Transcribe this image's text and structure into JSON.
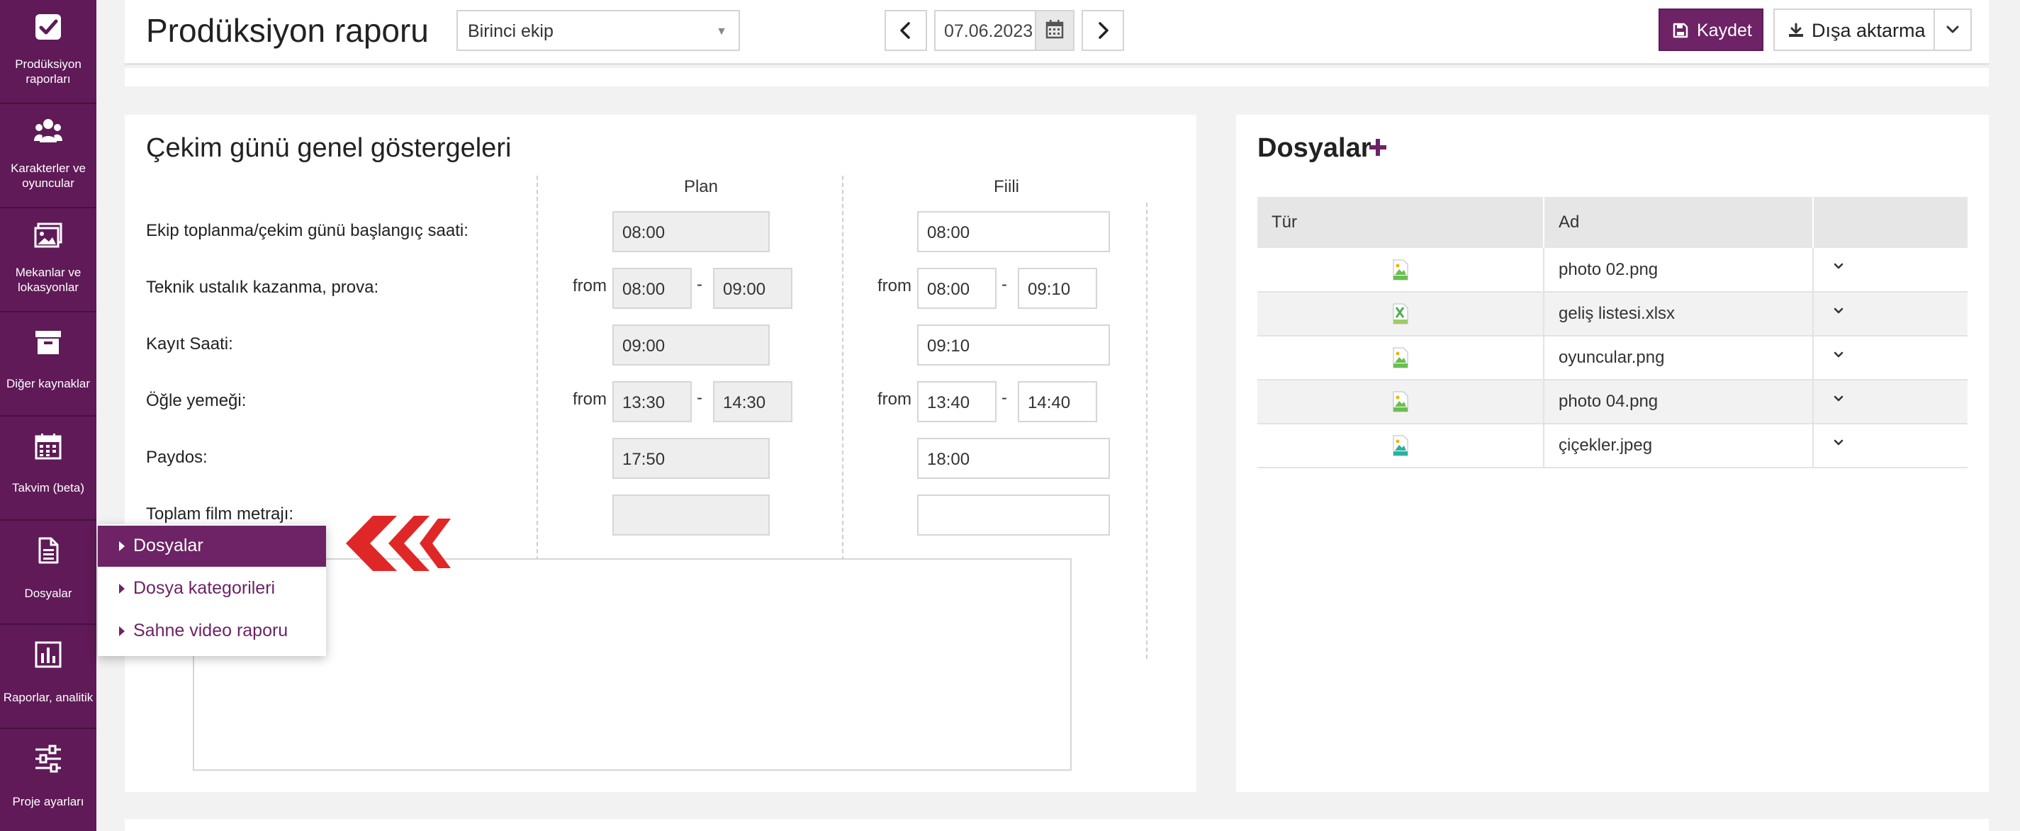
{
  "sidebar": {
    "items": [
      {
        "label": "Prodüksiyon raporları",
        "icon": "checkbox-icon"
      },
      {
        "label": "Karakterler ve oyuncular",
        "icon": "users-icon"
      },
      {
        "label": "Mekanlar ve lokasyonlar",
        "icon": "image-icon"
      },
      {
        "label": "Diğer kaynaklar",
        "icon": "archive-icon"
      },
      {
        "label": "Takvim (beta)",
        "icon": "calendar-icon"
      },
      {
        "label": "Dosyalar",
        "icon": "document-icon"
      },
      {
        "label": "Raporlar, analitik",
        "icon": "bar-chart-icon"
      },
      {
        "label": "Proje ayarları",
        "icon": "sliders-icon"
      }
    ]
  },
  "header": {
    "title": "Prodüksiyon raporu",
    "team_select": "Birinci ekip",
    "date": "07.06.2023",
    "save_label": "Kaydet",
    "export_label": "Dışa aktarma"
  },
  "indicators": {
    "title": "Çekim günü genel göstergeleri",
    "plan_header": "Plan",
    "actual_header": "Fiili",
    "from_label": "from",
    "range_sep": "-",
    "rows": [
      {
        "label": "Ekip toplanma/çekim günü başlangıç saati:",
        "plan": "08:00",
        "actual": "08:00"
      },
      {
        "label": "Teknik ustalık kazanma, prova:",
        "plan_from": "08:00",
        "plan_to": "09:00",
        "actual_from": "08:00",
        "actual_to": "09:10"
      },
      {
        "label": "Kayıt Saati:",
        "plan": "09:00",
        "actual": "09:10"
      },
      {
        "label": "Öğle yemeği:",
        "plan_from": "13:30",
        "plan_to": "14:30",
        "actual_from": "13:40",
        "actual_to": "14:40"
      },
      {
        "label": "Paydos:",
        "plan": "17:50",
        "actual": "18:00"
      },
      {
        "label": "Toplam film metrajı:",
        "plan": "",
        "actual": ""
      }
    ]
  },
  "dropdown": {
    "items": [
      {
        "label": "Dosyalar",
        "active": true
      },
      {
        "label": "Dosya kategorileri",
        "active": false
      },
      {
        "label": "Sahne video raporu",
        "active": false
      }
    ]
  },
  "files": {
    "title": "Dosyalar",
    "columns": [
      "Tür",
      "Ad",
      ""
    ],
    "rows": [
      {
        "type": "png",
        "name": "photo 02.png"
      },
      {
        "type": "xlsx",
        "name": "geliş listesi.xlsx"
      },
      {
        "type": "png",
        "name": "oyuncular.png"
      },
      {
        "type": "png",
        "name": "photo 04.png"
      },
      {
        "type": "jpeg",
        "name": "çiçekler.jpeg"
      }
    ]
  },
  "colors": {
    "brand": "#6e2366",
    "sidebar": "#5f1a57",
    "arrow": "#e02727",
    "png_icon": "#6bbf4e",
    "jpg_icon": "#2bb0a0"
  }
}
